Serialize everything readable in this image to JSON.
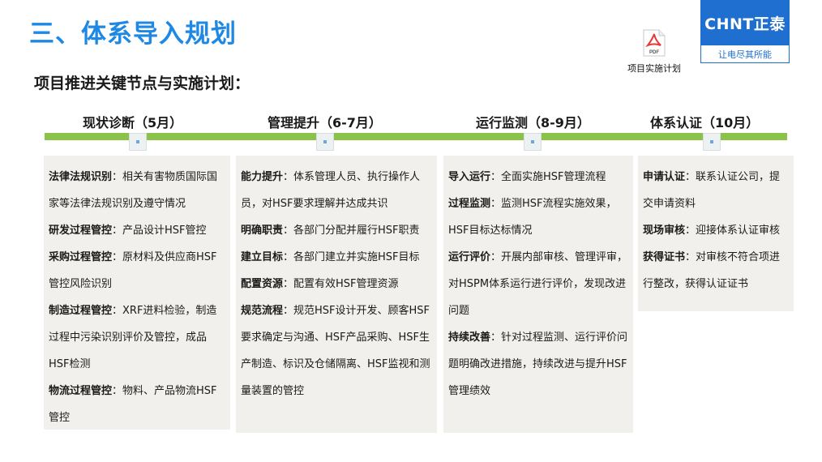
{
  "header": {
    "title": "三、体系导入规划",
    "subtitle": "项目推进关键节点与实施计划："
  },
  "logo": {
    "brand": "CHNT正泰",
    "slogan": "让电尽其所能"
  },
  "attachment": {
    "icon": "pdf-icon",
    "pdf_text": "PDF",
    "label": "项目实施计划"
  },
  "colors": {
    "title_blue": "#1e88e5",
    "timeline_green": "#8bc34a",
    "panel_bg": "#f1f0ec",
    "logo_blue": "#1e6fd0"
  },
  "phases": [
    {
      "label": "现状诊断（5月）",
      "items": [
        {
          "key": "法律法规识别",
          "text": "：相关有害物质国际国家等法律法规识别及遵守情况"
        },
        {
          "key": "研发过程管控",
          "text": "：产品设计HSF管控"
        },
        {
          "key": "采购过程管控",
          "text": "：原材料及供应商HSF管控风险识别"
        },
        {
          "key": "制造过程管控",
          "text": "：XRF进料检验，制造过程中污染识别评价及管控，成品HSF检测"
        },
        {
          "key": "物流过程管控",
          "text": "：物料、产品物流HSF管控"
        }
      ]
    },
    {
      "label": "管理提升（6-7月）",
      "items": [
        {
          "key": "能力提升",
          "text": "：体系管理人员、执行操作人员，对HSF要求理解并达成共识"
        },
        {
          "key": "明确职责",
          "text": "：各部门分配并履行HSF职责"
        },
        {
          "key": "建立目标",
          "text": "：各部门建立并实施HSF目标"
        },
        {
          "key": "配置资源",
          "text": "：配置有效HSF管理资源"
        },
        {
          "key": "规范流程",
          "text": "：规范HSF设计开发、顾客HSF要求确定与沟通、HSF产品采购、HSF生产制造、标识及仓储隔离、HSF监视和测量装置的管控"
        }
      ]
    },
    {
      "label": "运行监测（8-9月）",
      "items": [
        {
          "key": "导入运行",
          "text": "：全面实施HSF管理流程"
        },
        {
          "key": "过程监测",
          "text": "：监测HSF流程实施效果，HSF目标达标情况"
        },
        {
          "key": "运行评价",
          "text": "：开展内部审核、管理评审，对HSPM体系运行进行评价，发现改进问题"
        },
        {
          "key": "持续改善",
          "text": "：针对过程监测、运行评价问题明确改进措施，持续改进与提升HSF管理绩效"
        }
      ]
    },
    {
      "label": "体系认证（10月）",
      "items": [
        {
          "key": "申请认证",
          "text": "：联系认证公司，提交申请资料"
        },
        {
          "key": "现场审核",
          "text": "：迎接体系认证审核"
        },
        {
          "key": "获得证书",
          "text": "：对审核不符合项进行整改，获得认证证书"
        }
      ]
    }
  ]
}
